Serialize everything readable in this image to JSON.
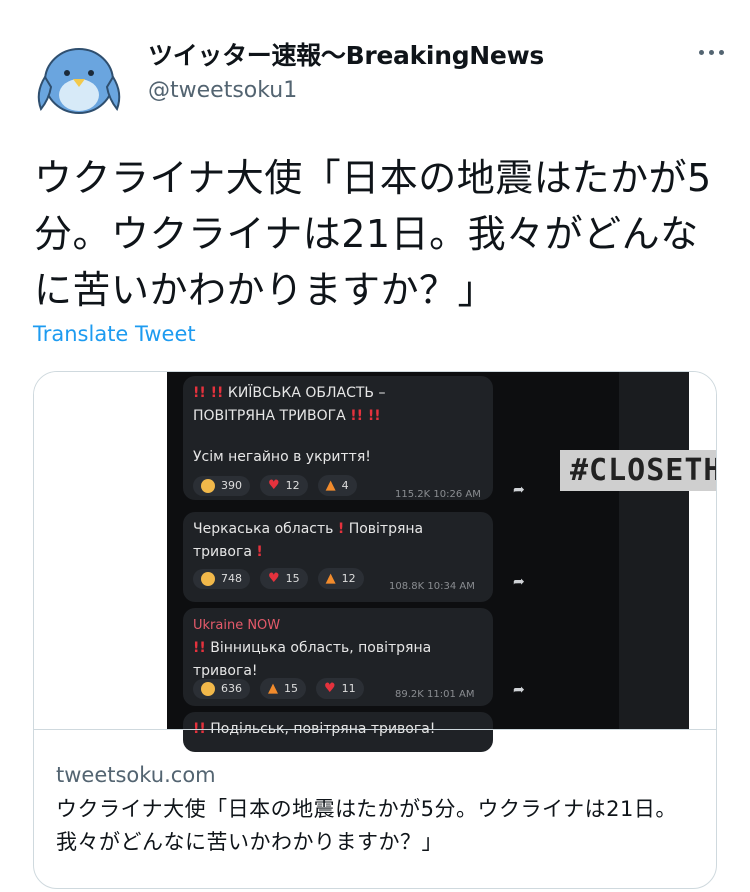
{
  "tweet": {
    "display_name": "ツイッター速報〜BreakingNews",
    "handle": "@tweetsoku1",
    "text": "ウクライナ大使「日本の地震はたかが5分。ウクライナは21日。我々がどんなに苦いかわかりますか？」",
    "translate": "Translate Tweet",
    "avatar_icon": "bird-avatar-icon",
    "more_icon": "more-options-icon"
  },
  "card": {
    "domain": "tweetsoku.com",
    "title": "ウクライナ大使「日本の地震はたかが5分。ウクライナは21日。我々がどんなに苦いかわかりますか？」",
    "media": {
      "hashtag": "#CLOSETHESKY",
      "messages": [
        {
          "line1": "КИЇВСЬКА ОБЛАСТЬ –",
          "line2": "ПОВІТРЯНА ТРИВОГА",
          "line3": "Усім негайно в укриття!",
          "reactions": [
            "390",
            "12",
            "4"
          ],
          "meta": "115.2K 10:26 AM"
        },
        {
          "line1": "Черкаська область",
          "line1b": "Повітряна",
          "line2": "тривога",
          "reactions": [
            "748",
            "15",
            "12"
          ],
          "meta": "108.8K 10:34 AM"
        },
        {
          "source": "Ukraine NOW",
          "line1": "Вінницька область, повітряна",
          "line2": "тривога!",
          "reactions": [
            "636",
            "15",
            "11"
          ],
          "meta": "89.2K 11:01 AM"
        },
        {
          "line1": "Подільськ, повітряна тривога!"
        }
      ]
    }
  }
}
